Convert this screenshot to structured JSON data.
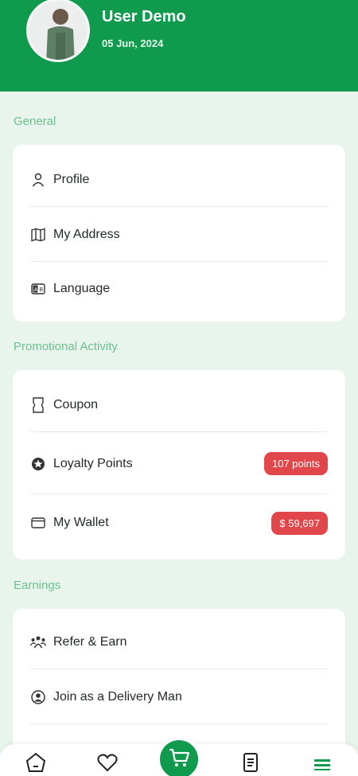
{
  "header": {
    "user_name": "User Demo",
    "date": "05 Jun, 2024"
  },
  "sections": {
    "general": {
      "title": "General",
      "items": [
        {
          "label": "Profile",
          "icon": "person-icon"
        },
        {
          "label": "My Address",
          "icon": "map-icon"
        },
        {
          "label": "Language",
          "icon": "language-icon"
        }
      ]
    },
    "promotional": {
      "title": "Promotional Activity",
      "items": [
        {
          "label": "Coupon",
          "icon": "coupon-icon"
        },
        {
          "label": "Loyalty Points",
          "icon": "star-badge-icon",
          "badge": "107 points"
        },
        {
          "label": "My Wallet",
          "icon": "wallet-icon",
          "badge": "$ 59,697"
        }
      ]
    },
    "earnings": {
      "title": "Earnings",
      "items": [
        {
          "label": "Refer & Earn",
          "icon": "refer-icon"
        },
        {
          "label": "Join as a Delivery Man",
          "icon": "delivery-man-icon"
        }
      ]
    }
  },
  "bottom_nav": {
    "items": [
      "home-icon",
      "heart-icon",
      "cart-icon",
      "orders-icon",
      "menu-icon"
    ]
  },
  "colors": {
    "primary": "#0f9a4e",
    "background": "#e9f5ec",
    "section_title": "#6cc08f",
    "badge": "#e0464a"
  }
}
